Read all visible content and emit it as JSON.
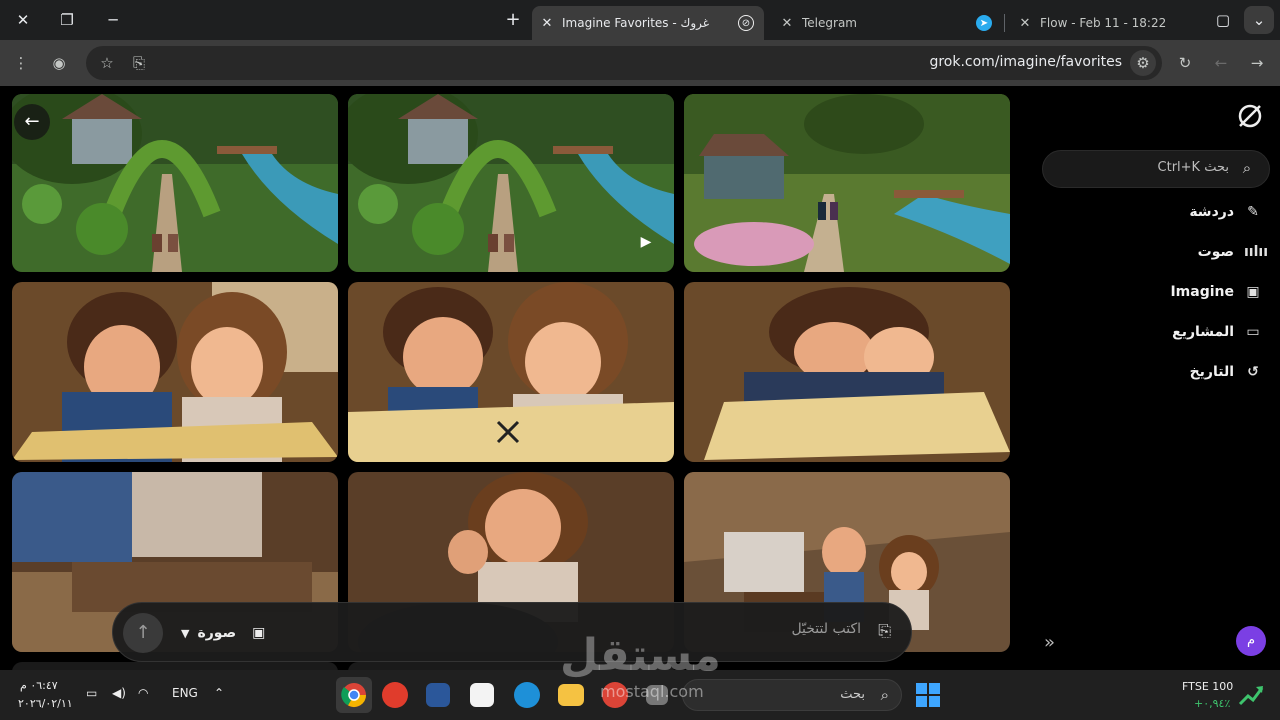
{
  "browser": {
    "tabs": [
      {
        "title": "Imagine Favorites - غروك",
        "active": true
      },
      {
        "title": "Telegram",
        "active": false
      },
      {
        "title": "Flow - Feb 11 - 18:22",
        "active": false
      }
    ],
    "new_tab": "+",
    "url": "grok.com/imagine/favorites"
  },
  "sidebar": {
    "search_label": "بحث Ctrl+K",
    "items": [
      {
        "label": "دردشة",
        "icon": "edit-icon"
      },
      {
        "label": "صوت",
        "icon": "voice-icon"
      },
      {
        "label": "Imagine",
        "icon": "image-icon"
      },
      {
        "label": "المشاريع",
        "icon": "folder-icon"
      },
      {
        "label": "التاريخ",
        "icon": "history-icon"
      }
    ],
    "avatar_initial": "م"
  },
  "prompt": {
    "placeholder": "اكتب لتتخيّل",
    "mode": "صورة"
  },
  "taskbar": {
    "time": "٠٦:٤٧ م",
    "date": "٢٠٢٦/٠٢/١١",
    "lang": "ENG",
    "search_label": "بحث",
    "ftse_name": "FTSE 100",
    "ftse_change": "+٠,٩٤٪"
  },
  "watermark": {
    "text": "مستقل",
    "sub": "mostaql.com"
  },
  "colors": {
    "accent_avatar": "#7b3fe4",
    "ftse_up": "#3ec46d"
  }
}
